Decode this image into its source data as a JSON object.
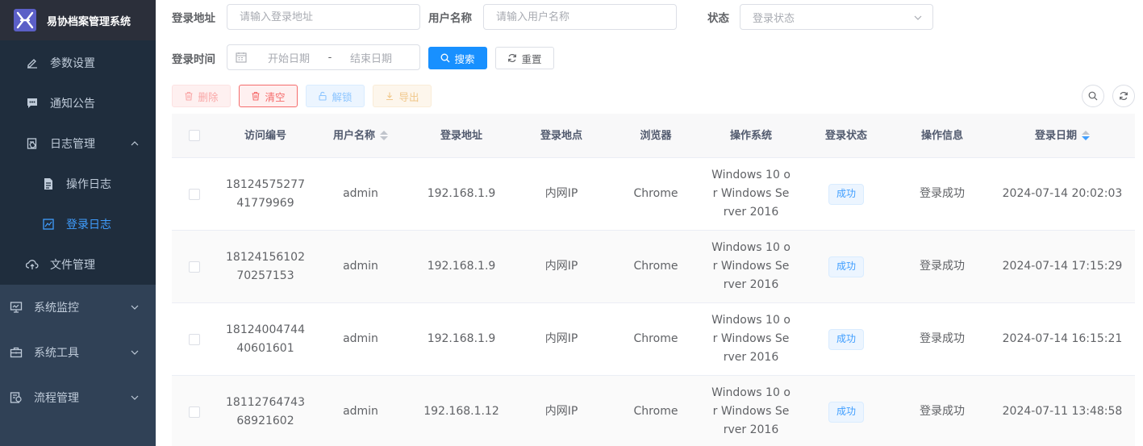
{
  "app": {
    "title": "易协档案管理系统"
  },
  "sidebar": {
    "items": [
      {
        "label": "参数设置",
        "icon": "edit-icon"
      },
      {
        "label": "通知公告",
        "icon": "message-icon"
      },
      {
        "label": "日志管理",
        "icon": "log-icon"
      },
      {
        "label": "操作日志",
        "icon": "form-icon"
      },
      {
        "label": "登录日志",
        "icon": "logininfor-icon"
      },
      {
        "label": "文件管理",
        "icon": "upload-cloud-icon"
      },
      {
        "label": "系统监控",
        "icon": "monitor-icon"
      },
      {
        "label": "系统工具",
        "icon": "tool-icon"
      },
      {
        "label": "流程管理",
        "icon": "process-icon"
      }
    ],
    "active_color": "#409eff"
  },
  "search": {
    "ip_label": "登录地址",
    "ip_placeholder": "请输入登录地址",
    "user_label": "用户名称",
    "user_placeholder": "请输入用户名称",
    "status_label": "状态",
    "status_placeholder": "登录状态",
    "time_label": "登录时间",
    "start_placeholder": "开始日期",
    "separator": "-",
    "end_placeholder": "结束日期",
    "search_btn": "搜索",
    "reset_btn": "重置"
  },
  "toolbar": {
    "delete": "删除",
    "clean": "清空",
    "unlock": "解锁",
    "export": "导出"
  },
  "table": {
    "headers": {
      "id": "访问编号",
      "user": "用户名称",
      "ip": "登录地址",
      "location": "登录地点",
      "browser": "浏览器",
      "os": "操作系统",
      "status": "登录状态",
      "msg": "操作信息",
      "date": "登录日期"
    },
    "rows": [
      {
        "id": "1812457527741779969",
        "user": "admin",
        "ip": "192.168.1.9",
        "location": "内网IP",
        "browser": "Chrome",
        "os": "Windows 10 or Windows Server 2016",
        "status": "成功",
        "msg": "登录成功",
        "date": "2024-07-14 20:02:03"
      },
      {
        "id": "1812415610270257153",
        "user": "admin",
        "ip": "192.168.1.9",
        "location": "内网IP",
        "browser": "Chrome",
        "os": "Windows 10 or Windows Server 2016",
        "status": "成功",
        "msg": "登录成功",
        "date": "2024-07-14 17:15:29"
      },
      {
        "id": "1812400474440601601",
        "user": "admin",
        "ip": "192.168.1.9",
        "location": "内网IP",
        "browser": "Chrome",
        "os": "Windows 10 or Windows Server 2016",
        "status": "成功",
        "msg": "登录成功",
        "date": "2024-07-14 16:15:21"
      },
      {
        "id": "1811276474368921602",
        "user": "admin",
        "ip": "192.168.1.12",
        "location": "内网IP",
        "browser": "Chrome",
        "os": "Windows 10 or Windows Server 2016",
        "status": "成功",
        "msg": "登录成功",
        "date": "2024-07-11 13:48:58"
      }
    ]
  }
}
